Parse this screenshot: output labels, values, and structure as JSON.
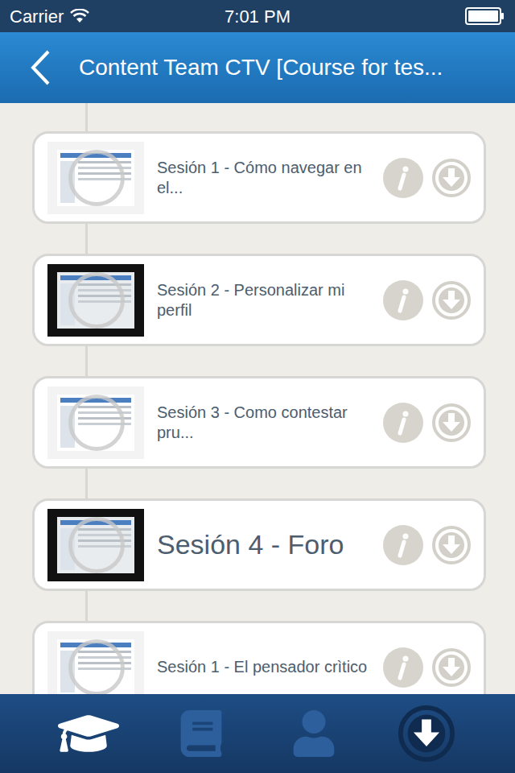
{
  "status_bar": {
    "carrier": "Carrier",
    "time": "7:01 PM",
    "wifi": true
  },
  "nav_bar": {
    "title": "Content Team CTV [Course for tes..."
  },
  "sessions": [
    {
      "title": "Sesión 1 - Cómo navegar en el...",
      "kind": "light",
      "emphasized": false
    },
    {
      "title": "Sesión 2 - Personalizar mi perfil",
      "kind": "dark",
      "emphasized": false
    },
    {
      "title": "Sesión 3 - Como contestar pru...",
      "kind": "light",
      "emphasized": false
    },
    {
      "title": "Sesión 4 - Foro",
      "kind": "dark",
      "emphasized": true
    },
    {
      "title": "Sesión  1 - El pensador crìtico",
      "kind": "light",
      "emphasized": false
    }
  ],
  "tab_bar": [
    {
      "selected": true
    },
    {
      "selected": false
    },
    {
      "selected": false
    },
    {
      "selected": false
    }
  ]
}
